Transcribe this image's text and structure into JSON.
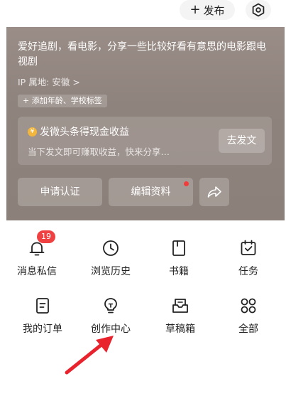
{
  "topbar": {
    "publish_label": "发布",
    "publish_icon": "plus-icon",
    "settings_icon": "hexagon-gear-icon"
  },
  "profile": {
    "bio": "爱好追剧，看电影，分享一些比较好看有意思的电影跟电视剧",
    "ip_location": "IP 属地: 安徽 >",
    "add_tags_label": "添加年龄、学校标签",
    "earnings_card": {
      "coin_symbol": "¥",
      "title": "发微头条得现金收益",
      "subtitle": "当下发文即可赚取收益，快来分享…",
      "post_button": "去发文"
    },
    "actions": {
      "verify": "申请认证",
      "edit": "编辑资料",
      "share_icon": "share-arrow-icon"
    },
    "colors": {
      "notification_dot": "#f23c3c",
      "coin": "#f2b63c"
    }
  },
  "grid": {
    "items": [
      {
        "label": "消息私信",
        "icon": "bell-icon",
        "badge": "19"
      },
      {
        "label": "浏览历史",
        "icon": "clock-icon"
      },
      {
        "label": "书籍",
        "icon": "book-icon"
      },
      {
        "label": "任务",
        "icon": "calendar-check-icon"
      },
      {
        "label": "我的订单",
        "icon": "order-list-icon"
      },
      {
        "label": "创作中心",
        "icon": "lightbulb-icon"
      },
      {
        "label": "草稿箱",
        "icon": "draft-box-icon"
      },
      {
        "label": "全部",
        "icon": "grid-icon"
      }
    ],
    "badge_color": "#f04142"
  },
  "annotation": {
    "arrow_color": "#e8232e",
    "points_to": "创作中心"
  }
}
